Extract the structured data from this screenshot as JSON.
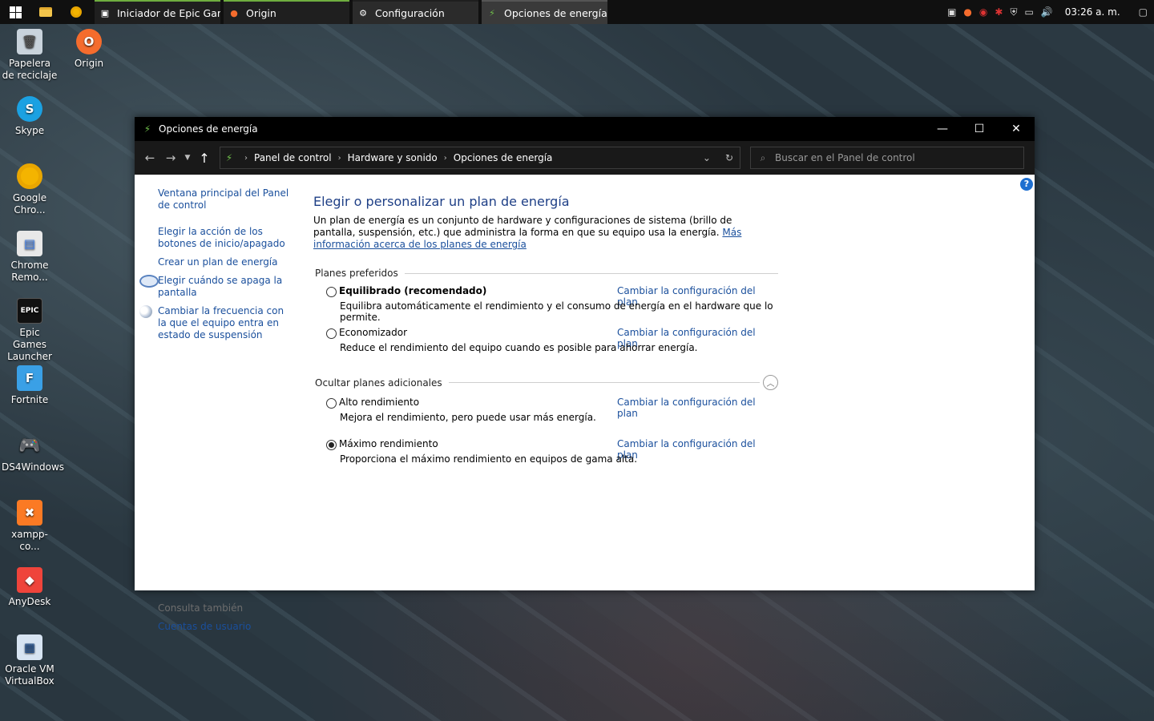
{
  "taskbar": {
    "tasks": [
      {
        "label": "Iniciador de Epic Gam...",
        "icon": "epic-icon"
      },
      {
        "label": "Origin",
        "icon": "origin-icon"
      },
      {
        "label": "Configuración",
        "icon": "gear-icon"
      },
      {
        "label": "Opciones de energía",
        "icon": "power-options-icon"
      }
    ],
    "clock": "03:26 a. m."
  },
  "desktop": {
    "icons": [
      {
        "label": "Papelera de reciclaje"
      },
      {
        "label": "Origin"
      },
      {
        "label": "Skype"
      },
      {
        "label": "Google Chro..."
      },
      {
        "label": "Chrome Remo..."
      },
      {
        "label": "Epic Games Launcher"
      },
      {
        "label": "Fortnite"
      },
      {
        "label": "DS4Windows"
      },
      {
        "label": "xampp-co..."
      },
      {
        "label": "AnyDesk"
      },
      {
        "label": "Oracle VM VirtualBox"
      }
    ]
  },
  "window": {
    "title": "Opciones de energía",
    "breadcrumb": [
      "Panel de control",
      "Hardware y sonido",
      "Opciones de energía"
    ],
    "search_placeholder": "Buscar en el Panel de control"
  },
  "sidebar": {
    "links": [
      "Ventana principal del Panel de control",
      "Elegir la acción de los botones de inicio/apagado",
      "Crear un plan de energía",
      "Elegir cuándo se apaga la pantalla",
      "Cambiar la frecuencia con la que el equipo entra en estado de suspensión"
    ],
    "see_also_heading": "Consulta también",
    "see_also_link": "Cuentas de usuario"
  },
  "main": {
    "heading": "Elegir o personalizar un plan de energía",
    "description": "Un plan de energía es un conjunto de hardware y configuraciones de sistema (brillo de pantalla, suspensión, etc.) que administra la forma en que su equipo usa la energía.",
    "more_info_link": "Más información acerca de los planes de energía",
    "preferred_heading": "Planes preferidos",
    "additional_heading": "Ocultar planes adicionales",
    "change_label": "Cambiar la configuración del plan",
    "plans": [
      {
        "name": "Equilibrado (recomendado)",
        "description": "Equilibra automáticamente el rendimiento y el consumo de energía en el hardware que lo permite.",
        "selected": false
      },
      {
        "name": "Economizador",
        "description": "Reduce el rendimiento del equipo cuando es posible para ahorrar energía.",
        "selected": false
      },
      {
        "name": "Alto rendimiento",
        "description": "Mejora el rendimiento, pero puede usar más energía.",
        "selected": false
      },
      {
        "name": "Máximo rendimiento",
        "description": "Proporciona el máximo rendimiento en equipos de gama alta.",
        "selected": true
      }
    ]
  }
}
